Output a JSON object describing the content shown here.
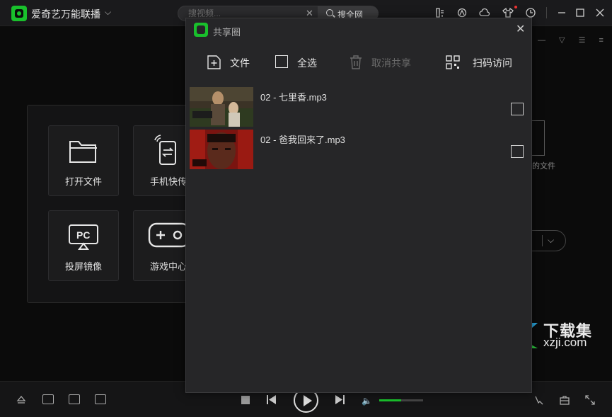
{
  "app": {
    "title": "爱奇艺万能联播",
    "accent": "#19c02c"
  },
  "search": {
    "placeholder": "搜视频...",
    "button_label": "搜全网"
  },
  "titlebar_icons": [
    "download-icon",
    "share-icon",
    "cloud-icon",
    "skin-icon",
    "history-icon",
    "minimize-icon",
    "maximize-icon",
    "close-icon"
  ],
  "main_tiles": [
    {
      "label": "打开文件",
      "icon": "folder-icon"
    },
    {
      "label": "手机快传",
      "icon": "phone-transfer-icon"
    },
    {
      "label": "投屏镜像",
      "icon": "pc-cast-icon"
    },
    {
      "label": "游戏中心",
      "icon": "gamepad-icon"
    }
  ],
  "right_hint": {
    "text": "的文件"
  },
  "dialog": {
    "title": "共享圈",
    "toolbar": {
      "file_label": "文件",
      "select_all_label": "全选",
      "cancel_share_label": "取消共享",
      "scan_label": "扫码访问"
    },
    "files": [
      {
        "name": "02 - 七里香.mp3",
        "checked": false
      },
      {
        "name": "02 - 爸我回来了.mp3",
        "checked": false
      }
    ]
  },
  "player": {
    "volume": 0.5
  },
  "watermark": {
    "cn": "下载集",
    "url": "xzji.com"
  }
}
